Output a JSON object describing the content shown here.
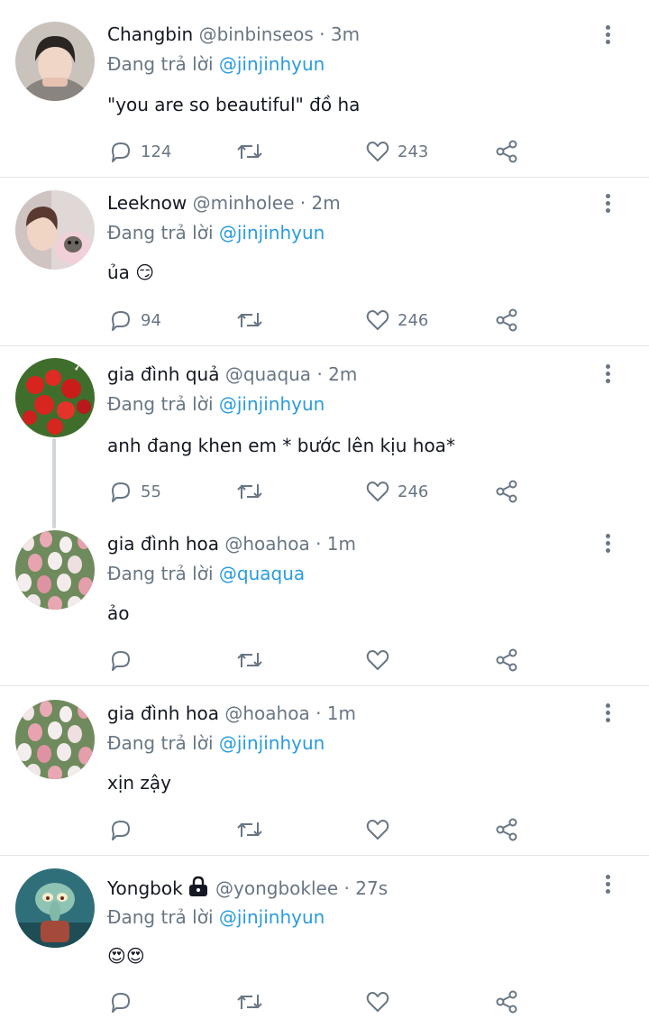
{
  "reply_prefix": "Đang trả lời",
  "tweets": [
    {
      "name": "Changbin",
      "handle": "@binbinseos",
      "separator": "·",
      "time": "3m",
      "reply_to": "@jinjinhyun",
      "text": "\"you are so beautiful\" đồ ha",
      "replies": "124",
      "likes": "243"
    },
    {
      "name": "Leeknow",
      "handle": "@minholee",
      "separator": "·",
      "time": "2m",
      "reply_to": "@jinjinhyun",
      "text": "ủa 😏",
      "replies": "94",
      "likes": "246"
    },
    {
      "name": "gia đình quả",
      "handle": "@quaqua",
      "separator": "·",
      "time": "2m",
      "reply_to": "@jinjinhyun",
      "text": "anh đang khen em * bước lên kịu hoa*",
      "replies": "55",
      "likes": "246"
    },
    {
      "name": "gia đình hoa",
      "handle": "@hoahoa",
      "separator": "·",
      "time": "1m",
      "reply_to": "@quaqua",
      "text": "ảo",
      "replies": "",
      "likes": ""
    },
    {
      "name": "gia đình hoa",
      "handle": "@hoahoa",
      "separator": "·",
      "time": "1m",
      "reply_to": "@jinjinhyun",
      "text": "xịn zậy",
      "replies": "",
      "likes": ""
    },
    {
      "name": "Yongbok",
      "handle": "@yongboklee",
      "separator": "·",
      "time": "27s",
      "reply_to": "@jinjinhyun",
      "text": "😍😍",
      "replies": "",
      "likes": ""
    }
  ],
  "icons": {
    "reply": "reply-icon",
    "retweet": "retweet-icon",
    "like": "heart-icon",
    "share": "share-icon",
    "more": "more-vertical-icon",
    "protected": "lock-icon"
  },
  "colors": {
    "mention": "#2a9be0",
    "secondary_text": "#687684",
    "divider": "#e1e5e9"
  }
}
